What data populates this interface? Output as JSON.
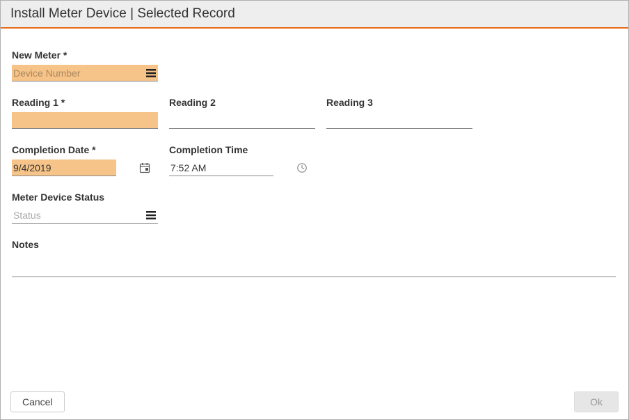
{
  "header": {
    "title": "Install Meter Device | Selected Record"
  },
  "fields": {
    "new_meter": {
      "label": "New Meter *",
      "placeholder": "Device Number",
      "value": ""
    },
    "reading1": {
      "label": "Reading 1 *",
      "value": ""
    },
    "reading2": {
      "label": "Reading 2",
      "value": ""
    },
    "reading3": {
      "label": "Reading 3",
      "value": ""
    },
    "completion_date": {
      "label": "Completion Date *",
      "value": "9/4/2019"
    },
    "completion_time": {
      "label": "Completion Time",
      "value": "7:52 AM"
    },
    "meter_status": {
      "label": "Meter Device Status",
      "placeholder": "Status",
      "value": ""
    },
    "notes": {
      "label": "Notes",
      "value": ""
    }
  },
  "footer": {
    "cancel": "Cancel",
    "ok": "Ok"
  },
  "colors": {
    "accent": "#e86c1a",
    "required_bg": "#f6c388"
  }
}
